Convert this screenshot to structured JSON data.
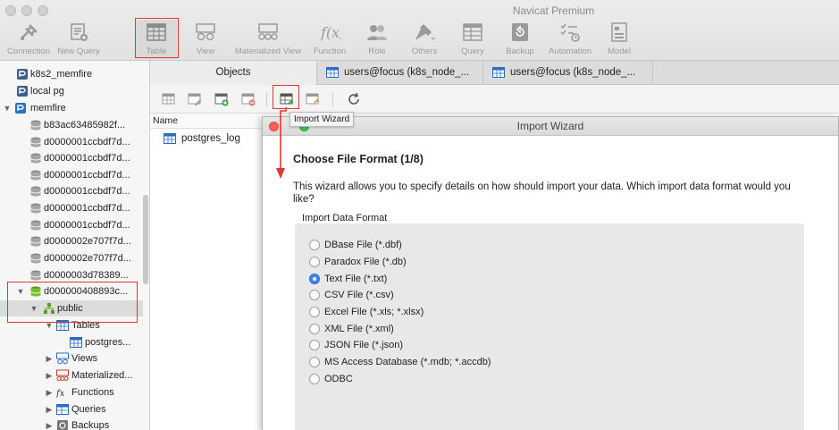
{
  "app": {
    "title": "Navicat Premium"
  },
  "toolbar": [
    {
      "label": "Connection",
      "icon": "connection-icon"
    },
    {
      "label": "New Query",
      "icon": "new-query-icon"
    },
    {
      "label": "Table",
      "icon": "table-icon",
      "selected": true
    },
    {
      "label": "View",
      "icon": "view-icon"
    },
    {
      "label": "Materialized View",
      "icon": "materialized-view-icon"
    },
    {
      "label": "Function",
      "icon": "function-icon"
    },
    {
      "label": "Role",
      "icon": "role-icon"
    },
    {
      "label": "Others",
      "icon": "others-icon"
    },
    {
      "label": "Query",
      "icon": "query-icon"
    },
    {
      "label": "Backup",
      "icon": "backup-icon"
    },
    {
      "label": "Automation",
      "icon": "automation-icon"
    },
    {
      "label": "Model",
      "icon": "model-icon"
    }
  ],
  "tabs": [
    {
      "label": "Objects",
      "active": true
    },
    {
      "label": "users@focus (k8s_node_..."
    },
    {
      "label": "users@focus (k8s_node_..."
    }
  ],
  "sidebar": {
    "items": [
      {
        "label": "k8s2_memfire"
      },
      {
        "label": "local pg"
      },
      {
        "label": "memfire"
      },
      {
        "label": "b83ac63485982f..."
      },
      {
        "label": "d0000001ccbdf7d..."
      },
      {
        "label": "d0000001ccbdf7d..."
      },
      {
        "label": "d0000001ccbdf7d..."
      },
      {
        "label": "d0000001ccbdf7d..."
      },
      {
        "label": "d0000001ccbdf7d..."
      },
      {
        "label": "d0000001ccbdf7d..."
      },
      {
        "label": "d0000002e707f7d..."
      },
      {
        "label": "d0000002e707f7d..."
      },
      {
        "label": "d0000003d78389..."
      },
      {
        "label": "d000000408893c..."
      },
      {
        "label": "public"
      },
      {
        "label": "Tables"
      },
      {
        "label": "postgres..."
      },
      {
        "label": "Views"
      },
      {
        "label": "Materialized..."
      },
      {
        "label": "Functions"
      },
      {
        "label": "Queries"
      },
      {
        "label": "Backups"
      }
    ]
  },
  "objects": {
    "column_name": "Name",
    "items": [
      {
        "label": "postgres_log"
      }
    ],
    "tooltip": "Import Wizard"
  },
  "wizard": {
    "title": "Import Wizard",
    "step": "Choose File Format (1/8)",
    "description": "This wizard allows you to specify details on how should import your data. Which import data format would you like?",
    "format_label": "Import Data Format",
    "selected": "Text File (*.txt)",
    "options": [
      {
        "label": "DBase File (*.dbf)"
      },
      {
        "label": "Paradox File (*.db)"
      },
      {
        "label": "Text File (*.txt)"
      },
      {
        "label": "CSV File (*.csv)"
      },
      {
        "label": "Excel File (*.xls; *.xlsx)"
      },
      {
        "label": "XML File (*.xml)"
      },
      {
        "label": "JSON File (*.json)"
      },
      {
        "label": "MS Access Database (*.mdb; *.accdb)"
      },
      {
        "label": "ODBC"
      }
    ]
  },
  "colors": {
    "annotation": "#e03a2f",
    "accent": "#3b84f0",
    "close": "#fc605c"
  }
}
